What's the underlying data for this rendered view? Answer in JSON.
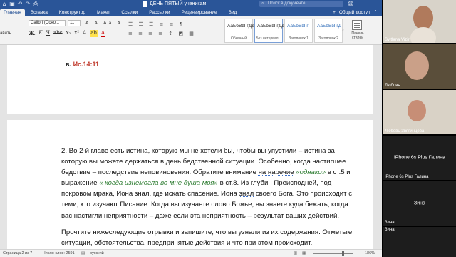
{
  "window": {
    "title": "ДЕНЬ ПЯТЫЙ ученикам",
    "search_placeholder": "Поиск в документе"
  },
  "ribbon": {
    "tabs": [
      "Главная",
      "Вставка",
      "Конструктор",
      "Макет",
      "Ссылки",
      "Рассылки",
      "Рецензирование",
      "Вид"
    ],
    "active_tab": "Главная",
    "share_label": "Общий доступ",
    "insert_label": "авить",
    "font_name": "Calibri (Осно...",
    "font_size": "11",
    "styles": [
      {
        "sample": "АаБбВвГгДд",
        "name": "Обычный"
      },
      {
        "sample": "АаБбВвГгДд",
        "name": "Без интервал..."
      },
      {
        "sample": "АаБбВвГг",
        "name": "Заголовок 1"
      },
      {
        "sample": "АаБбВвГгД",
        "name": "Заголовок 2"
      }
    ],
    "style_pane_label": "Панель стилей"
  },
  "document": {
    "page1_ref_prefix": "в.",
    "page1_ref": "Ис.14:11",
    "para1": {
      "a": "2. Во 2-й главе есть истина, которую мы не хотели бы, чтобы вы упустили – истина за которую вы можете держаться в день бедственной ситуации. Особенно, когда настигшее бедствие – последствие неповиновения. Обратите внимание ",
      "b": "на  наречие",
      "c": " «однако»",
      "d": "  в ст.5 и выражение ",
      "e": "« когда изнемогла во мне душа моя»",
      "f": " в ст.8. ",
      "g": "Из",
      "h": " глубин Преисподней, под покровом мрака, Иона знал, где искать спасение. Иона ",
      "i": "знал",
      "j": " своего Бога. Это происходит с теми, кто изучают Писание. Когда вы изучаете слово Божье, вы знаете куда бежать, когда вас настигли неприятности – даже если эта неприятность – результат ваших действий."
    },
    "para2": "Прочтите нижеследующие отрывки и запишите, что вы узнали из их содержания. Отметьте ситуации, обстоятельства, предпринятые действия и что при этом происходит."
  },
  "status": {
    "page": "Страница 2 из 7",
    "words": "Число слов: 2591",
    "language": "русский",
    "zoom": "186%"
  },
  "participants": [
    {
      "name": "Svitlana Vizir",
      "label": ""
    },
    {
      "name": "Любовь",
      "label": ""
    },
    {
      "name": "Любовь Звягинцева",
      "label": ""
    },
    {
      "name": "iPhone 6s Plus Галина",
      "label": "iPhone 6s Plus Галина"
    },
    {
      "name": "Зина",
      "label": "Зина"
    },
    {
      "name": "Зина",
      "label": ""
    }
  ],
  "colors": {
    "word_blue": "#2a5598",
    "reference_red": "#c0392b",
    "quote_green": "#2e7d32"
  }
}
